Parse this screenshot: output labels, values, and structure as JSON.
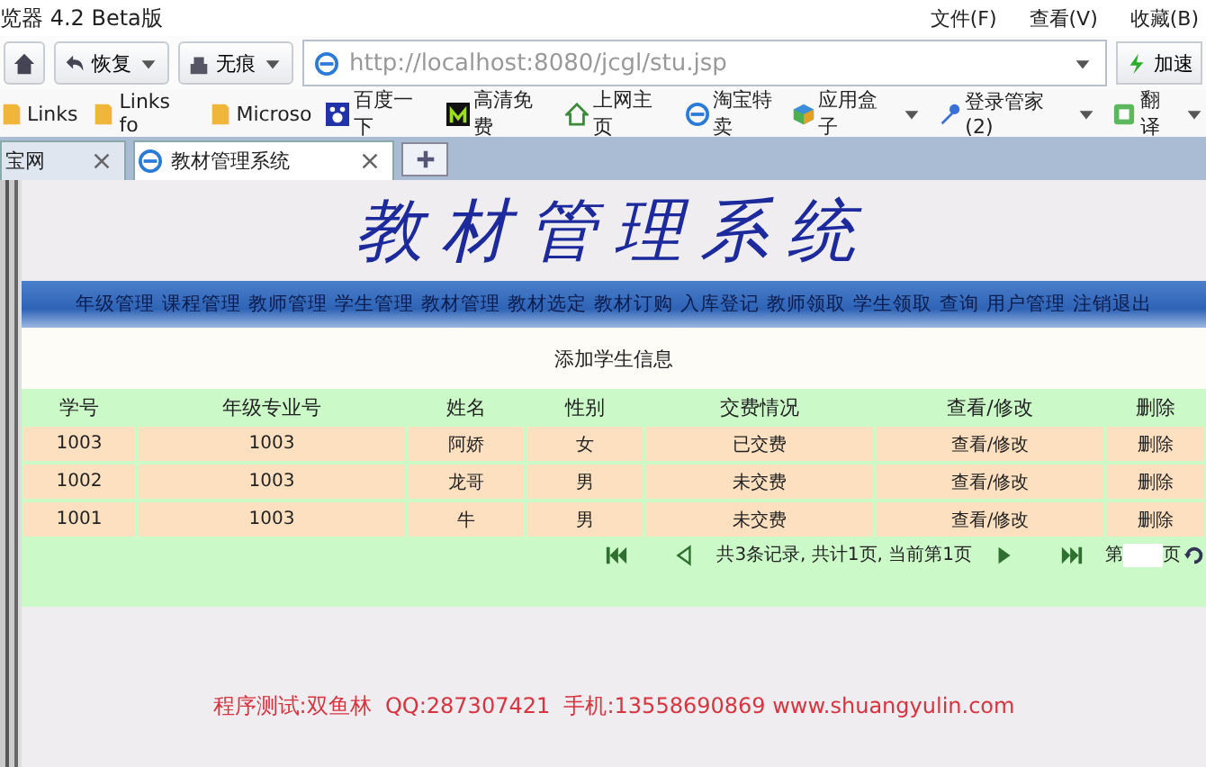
{
  "window": {
    "title": "览器 4.2 Beta版",
    "menu": [
      "文件(F)",
      "查看(V)",
      "收藏(B)"
    ]
  },
  "toolbar": {
    "buttons": [
      {
        "kind": "home"
      },
      {
        "kind": "restore",
        "label": "恢复"
      },
      {
        "kind": "private",
        "label": "无痕"
      }
    ],
    "address": "http://localhost:8080/jcgl/stu.jsp",
    "speed": "加速"
  },
  "bookmarks": [
    {
      "kind": "folder",
      "label": "Links"
    },
    {
      "kind": "folder",
      "label": "Links fo"
    },
    {
      "kind": "folder",
      "label": "Microso"
    },
    {
      "kind": "paw",
      "label": "百度一下"
    },
    {
      "kind": "m",
      "label": "高清免费"
    },
    {
      "kind": "house",
      "label": "上网主页"
    },
    {
      "kind": "ie",
      "label": "淘宝特卖"
    }
  ],
  "bookmarks_right": [
    {
      "kind": "cube",
      "label": "应用盒子"
    },
    {
      "kind": "key",
      "label": "登录管家(2)"
    },
    {
      "kind": "translate",
      "label": "翻译"
    }
  ],
  "tabs": [
    {
      "label": "宝网",
      "selected": false
    },
    {
      "label": "教材管理系统",
      "selected": true
    }
  ],
  "page": {
    "title": "教材管理系统",
    "nav": [
      "年级管理",
      "课程管理",
      "教师管理",
      "学生管理",
      "教材管理",
      "教材选定",
      "教材订购",
      "入库登记",
      "教师领取",
      "学生领取",
      "查询",
      "用户管理",
      "注销退出"
    ],
    "heading": "添加学生信息",
    "columns": [
      "学号",
      "年级专业号",
      "姓名",
      "性别",
      "交费情况",
      "查看/修改",
      "删除"
    ],
    "rows": [
      [
        "1003",
        "1003",
        "阿娇",
        "女",
        "已交费",
        "查看/修改",
        "删除"
      ],
      [
        "1002",
        "1003",
        "龙哥",
        "男",
        "未交费",
        "查看/修改",
        "删除"
      ],
      [
        "1001",
        "1003",
        "牛",
        "男",
        "未交费",
        "查看/修改",
        "删除"
      ]
    ],
    "pagination": {
      "info": "共3条记录, 共计1页, 当前第1页",
      "before": "第",
      "after": "页"
    },
    "footer": "程序测试:双鱼林  QQ:287307421  手机:13558690869 www.shuangyulin.com"
  }
}
